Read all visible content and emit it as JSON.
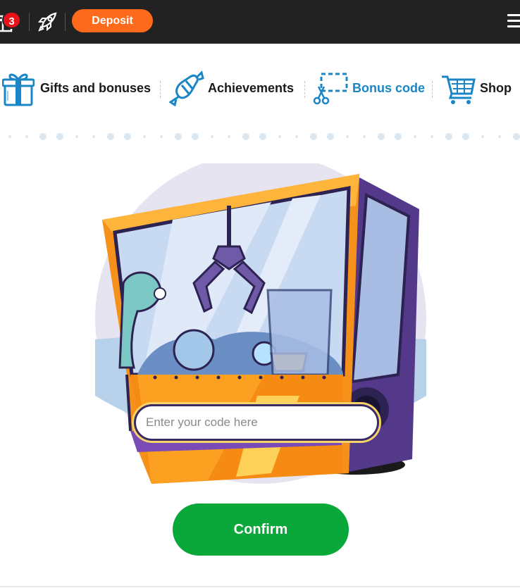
{
  "topbar": {
    "notification_count": "3",
    "deposit_label": "Deposit"
  },
  "nav": {
    "items": [
      {
        "label": "Gifts and bonuses",
        "icon": "gift-icon",
        "active": false
      },
      {
        "label": "Achievements",
        "icon": "candy-icon",
        "active": false
      },
      {
        "label": "Bonus code",
        "icon": "scissors-coupon-icon",
        "active": true
      },
      {
        "label": "Shop",
        "icon": "cart-icon",
        "active": false
      }
    ]
  },
  "bonus_code": {
    "input_value": "",
    "input_placeholder": "Enter your code here",
    "confirm_label": "Confirm"
  },
  "colors": {
    "topbar_bg": "#222222",
    "deposit": "#fe6a1c",
    "badge": "#e8121b",
    "active_nav": "#1a86c6",
    "confirm": "#0aa83a"
  }
}
